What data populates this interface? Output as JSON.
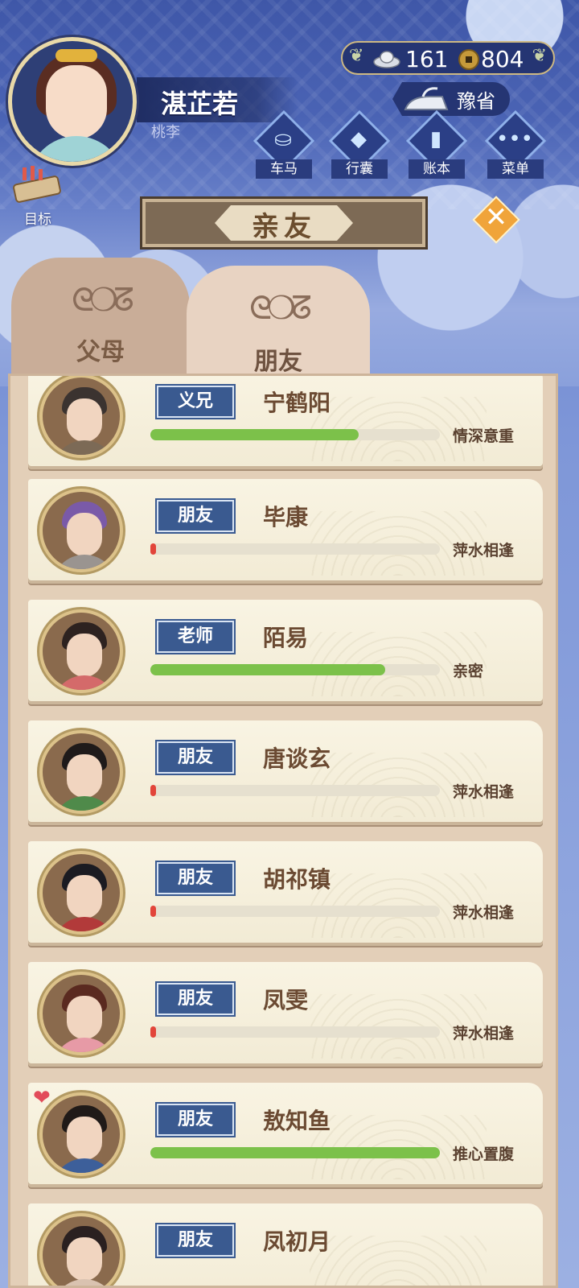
{
  "player": {
    "name": "湛芷若",
    "title": "桃李",
    "goal_label": "目标"
  },
  "currency": {
    "silver": "161",
    "coins": "804"
  },
  "location": {
    "label": "豫省"
  },
  "menu": {
    "items": [
      {
        "label": "车马",
        "icon": "carriage-icon"
      },
      {
        "label": "行囊",
        "icon": "bag-icon"
      },
      {
        "label": "账本",
        "icon": "ledger-icon"
      },
      {
        "label": "菜单",
        "icon": "more-icon"
      }
    ]
  },
  "panel": {
    "title": "亲友",
    "tabs": [
      {
        "label": "父母",
        "active": false
      },
      {
        "label": "朋友",
        "active": true
      }
    ]
  },
  "friends": [
    {
      "relation": "义兄",
      "name": "宁鹤阳",
      "level": "情深意重",
      "affinity": 0.72,
      "heart": false
    },
    {
      "relation": "朋友",
      "name": "毕康",
      "level": "萍水相逢",
      "affinity": 0.02,
      "heart": false
    },
    {
      "relation": "老师",
      "name": "陌易",
      "level": "亲密",
      "affinity": 0.81,
      "heart": false
    },
    {
      "relation": "朋友",
      "name": "唐谈玄",
      "level": "萍水相逢",
      "affinity": 0.02,
      "heart": false
    },
    {
      "relation": "朋友",
      "name": "胡祁镇",
      "level": "萍水相逢",
      "affinity": 0.02,
      "heart": false
    },
    {
      "relation": "朋友",
      "name": "凤雯",
      "level": "萍水相逢",
      "affinity": 0.02,
      "heart": false
    },
    {
      "relation": "朋友",
      "name": "敖知鱼",
      "level": "推心置腹",
      "affinity": 1.0,
      "heart": true
    },
    {
      "relation": "朋友",
      "name": "凤初月",
      "level": "",
      "affinity": null,
      "heart": false
    }
  ],
  "colors": {
    "affinity_high": "#7cc14a",
    "affinity_low": "#e2453a",
    "relation_badge": "#3a5a90"
  }
}
